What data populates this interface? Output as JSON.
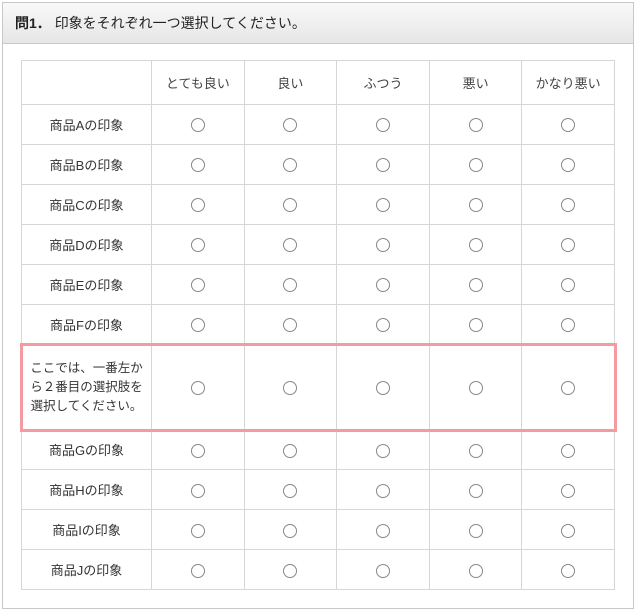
{
  "question": {
    "number_label": "問1．",
    "text": "印象をそれぞれ一つ選択してください。"
  },
  "columns": [
    "とても良い",
    "良い",
    "ふつう",
    "悪い",
    "かなり悪い"
  ],
  "rows": [
    {
      "label": "商品Aの印象",
      "highlighted": false
    },
    {
      "label": "商品Bの印象",
      "highlighted": false
    },
    {
      "label": "商品Cの印象",
      "highlighted": false
    },
    {
      "label": "商品Dの印象",
      "highlighted": false
    },
    {
      "label": "商品Eの印象",
      "highlighted": false
    },
    {
      "label": "商品Fの印象",
      "highlighted": false
    },
    {
      "label": "ここでは、一番左から２番目の選択肢を選択してください。",
      "highlighted": true
    },
    {
      "label": "商品Gの印象",
      "highlighted": false
    },
    {
      "label": "商品Hの印象",
      "highlighted": false
    },
    {
      "label": "商品Iの印象",
      "highlighted": false
    },
    {
      "label": "商品Jの印象",
      "highlighted": false
    }
  ]
}
